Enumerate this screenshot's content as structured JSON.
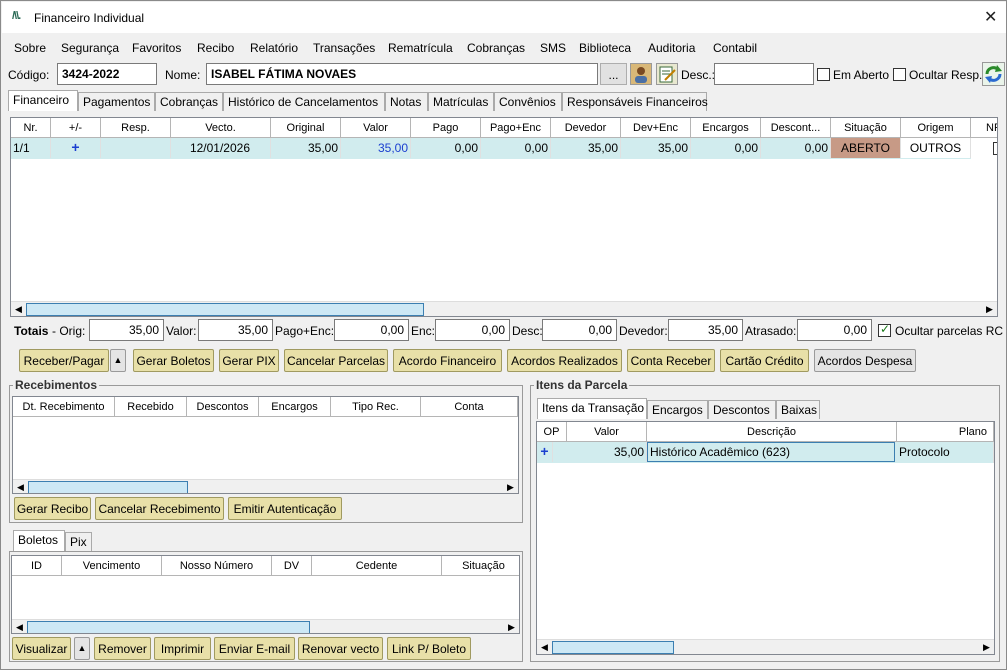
{
  "window": {
    "title": "Financeiro Individual",
    "logo": "/\\\\."
  },
  "menu": [
    "Sobre",
    "Segurança",
    "Favoritos",
    "Recibo",
    "Relatório",
    "Transações",
    "Rematrícula",
    "Cobranças",
    "SMS",
    "Biblioteca",
    "Auditoria",
    "Contabil"
  ],
  "header": {
    "codigo_label": "Código:",
    "codigo_value": "3424-2022",
    "nome_label": "Nome:",
    "nome_value": "ISABEL FÁTIMA NOVAES",
    "ellipsis": "...",
    "desc_label": "Desc.:",
    "desc_value": "",
    "em_aberto_label": "Em Aberto",
    "em_aberto_checked": false,
    "ocultar_resp_label": "Ocultar Resp.",
    "ocultar_resp_checked": false
  },
  "main_tabs": [
    "Financeiro",
    "Pagamentos",
    "Cobranças",
    "Histórico de Cancelamentos",
    "Notas",
    "Matrículas",
    "Convênios",
    "Responsáveis Financeiros"
  ],
  "parcelas": {
    "columns": [
      "Nr.",
      "+/-",
      "Resp.",
      "Vecto.",
      "Original",
      "Valor",
      "Pago",
      "Pago+Enc",
      "Devedor",
      "Dev+Enc",
      "Encargos",
      "Descont...",
      "Situação",
      "Origem",
      "NF"
    ],
    "rows": [
      {
        "nr": "1/1",
        "pm": "+",
        "resp": "",
        "vecto": "12/01/2026",
        "original": "35,00",
        "valor": "35,00",
        "pago": "0,00",
        "pago_enc": "0,00",
        "devedor": "35,00",
        "dev_enc": "35,00",
        "encargos": "0,00",
        "desconto": "0,00",
        "situacao": "ABERTO",
        "origem": "OUTROS"
      }
    ]
  },
  "totais": {
    "label": "Totais",
    "orig_label": "- Orig:",
    "orig": "35,00",
    "valor_label": "Valor:",
    "valor": "35,00",
    "pago_enc_label": "Pago+Enc:",
    "pago_enc": "0,00",
    "enc_label": "Enc:",
    "enc": "0,00",
    "desc_label": "Desc:",
    "desc": "0,00",
    "devedor_label": "Devedor:",
    "devedor": "35,00",
    "atrasado_label": "Atrasado:",
    "atrasado": "0,00",
    "ocultar_label": "Ocultar parcelas RC",
    "ocultar_checked": true
  },
  "actions": {
    "receber_pagar": "Receber/Pagar",
    "gerar_boletos": "Gerar Boletos",
    "gerar_pix": "Gerar PIX",
    "cancelar_parcelas": "Cancelar Parcelas",
    "acordo_financeiro": "Acordo Financeiro",
    "acordos_realizados": "Acordos Realizados",
    "conta_receber": "Conta Receber",
    "cartao_credito": "Cartão Crédito",
    "acordos_despesa": "Acordos Despesa"
  },
  "recebimentos": {
    "title": "Recebimentos",
    "columns": [
      "Dt. Recebimento",
      "Recebido",
      "Descontos",
      "Encargos",
      "Tipo Rec.",
      "Conta"
    ],
    "buttons": {
      "gerar_recibo": "Gerar Recibo",
      "cancelar": "Cancelar Recebimento",
      "emitir": "Emitir Autenticação"
    }
  },
  "boletos": {
    "tabs": [
      "Boletos",
      "Pix"
    ],
    "columns": [
      "ID",
      "Vencimento",
      "Nosso Número",
      "DV",
      "Cedente",
      "Situação"
    ],
    "buttons": {
      "visualizar": "Visualizar",
      "remover": "Remover",
      "imprimir": "Imprimir",
      "enviar": "Enviar E-mail",
      "renovar": "Renovar vecto",
      "link": "Link P/ Boleto"
    }
  },
  "itens": {
    "title": "Itens da Parcela",
    "tabs": [
      "Itens da Transação",
      "Encargos",
      "Descontos",
      "Baixas"
    ],
    "columns": [
      "OP",
      "Valor",
      "Descrição",
      "Plano"
    ],
    "rows": [
      {
        "op": "+",
        "valor": "35,00",
        "descricao": "Histórico Acadêmico (623)",
        "plano": "Protocolo"
      }
    ]
  },
  "colors": {
    "situacao_bg": "#c79a86",
    "row_sel": "#d1ecee",
    "button_yellow": "#e8e0a8"
  }
}
